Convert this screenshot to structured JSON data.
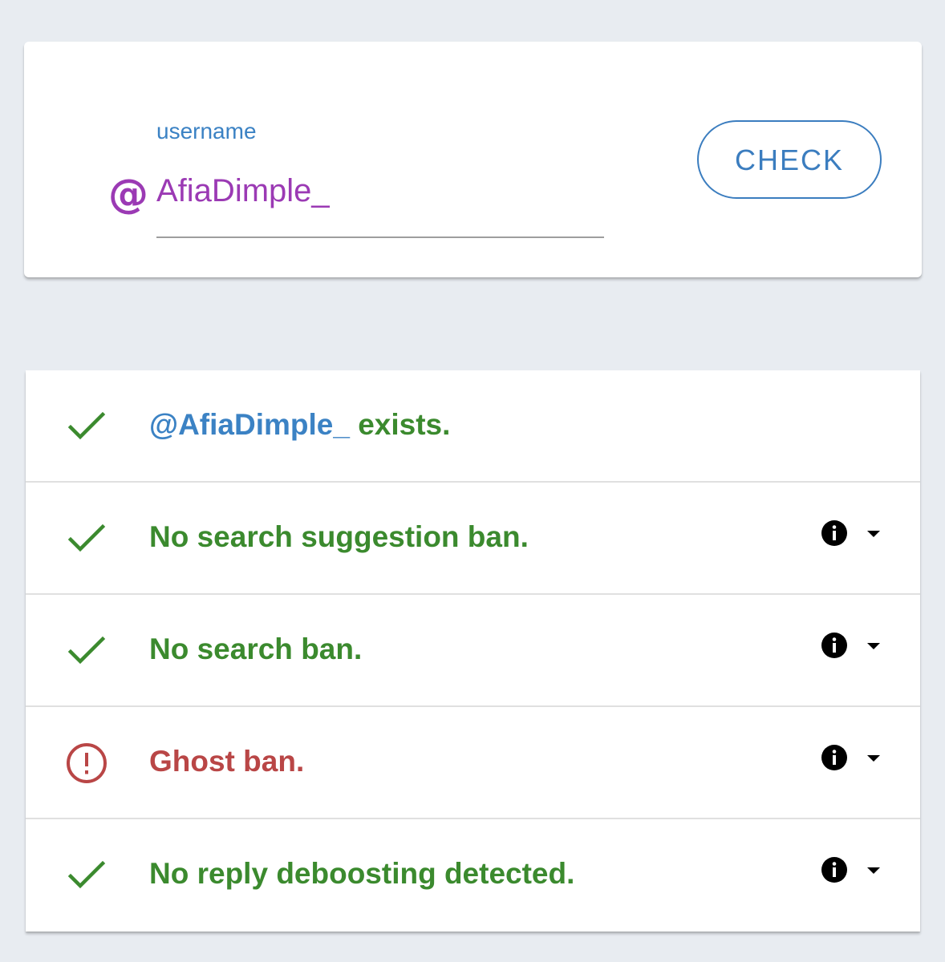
{
  "search": {
    "label": "username",
    "prefix_symbol": "@",
    "value": "AfiaDimple_",
    "button_label": "CHECK"
  },
  "results": {
    "exists": {
      "handle": "@AfiaDimple_",
      "text": " exists.",
      "status": "ok"
    },
    "search_suggestion_ban": {
      "text": "No search suggestion ban.",
      "status": "ok"
    },
    "search_ban": {
      "text": "No search ban.",
      "status": "ok"
    },
    "ghost_ban": {
      "text": "Ghost ban.",
      "status": "warning"
    },
    "reply_deboosting": {
      "text": "No reply deboosting detected.",
      "status": "ok"
    }
  },
  "icons": {
    "ok": "checkmark-icon",
    "warning": "alert-circle-icon",
    "info": "info-icon",
    "expand": "caret-down-icon"
  },
  "colors": {
    "ok": "#3b8a2e",
    "warning": "#b94646",
    "accent": "#3b7dbf",
    "input": "#9b3ab4"
  }
}
